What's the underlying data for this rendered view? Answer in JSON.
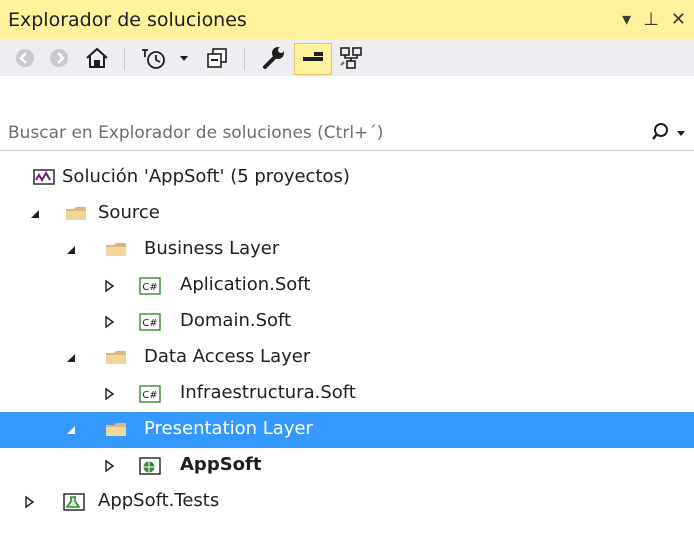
{
  "panel": {
    "title": "Explorador de soluciones",
    "controls": {
      "dropdown": "▾",
      "pin": "⊥",
      "close": "✕"
    }
  },
  "toolbar": {
    "buttons": [
      "back-icon",
      "forward-icon",
      "home-icon",
      "pending-changes-icon",
      "dropdown-icon",
      "collapse-all-icon",
      "properties-icon",
      "preview-selected-icon",
      "class-diagram-icon"
    ]
  },
  "search": {
    "placeholder": "Buscar en Explorador de soluciones (Ctrl+´)"
  },
  "tree": {
    "solution": "Solución 'AppSoft'  (5 proyectos)",
    "source": "Source",
    "business_layer": "Business Layer",
    "aplication_soft": "Aplication.Soft",
    "domain_soft": "Domain.Soft",
    "data_access_layer": "Data Access Layer",
    "infraestructura_soft": "Infraestructura.Soft",
    "presentation_layer": "Presentation Layer",
    "appsoft": "AppSoft",
    "appsoft_tests": "AppSoft.Tests"
  },
  "colors": {
    "title_bg": "#fff29d",
    "toolbar_bg": "#eeeef2",
    "selection": "#3399ff",
    "folder": "#dcb67a"
  }
}
